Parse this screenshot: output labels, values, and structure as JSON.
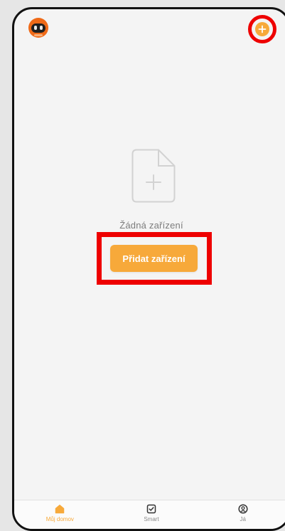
{
  "colors": {
    "page_bg": "#e6e6e6",
    "screen_bg": "#f4f4f4",
    "accent": "#f7a93a",
    "highlight": "#ee0000"
  },
  "header": {
    "avatar_icon": "robot-avatar-icon",
    "add_icon": "plus-circle-icon"
  },
  "main": {
    "empty_icon": "document-add-icon",
    "empty_text": "Žádná zařízení",
    "add_button_label": "Přidat zařízení"
  },
  "tabbar": {
    "tabs": [
      {
        "label": "Můj domov",
        "icon": "home-icon",
        "active": true
      },
      {
        "label": "Smart",
        "icon": "checkbox-icon",
        "active": false
      },
      {
        "label": "Já",
        "icon": "profile-icon",
        "active": false
      }
    ]
  }
}
